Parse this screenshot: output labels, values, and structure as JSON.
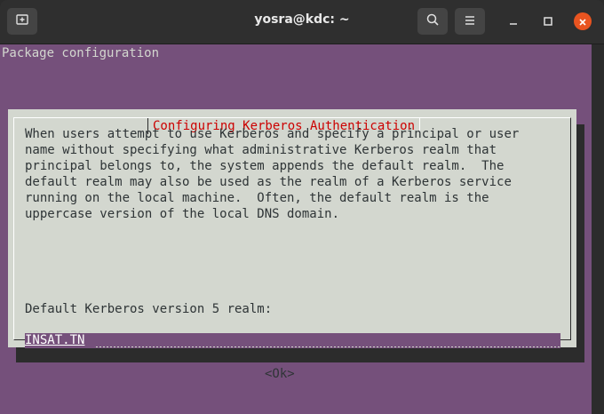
{
  "window": {
    "title": "yosra@kdc: ~"
  },
  "terminal": {
    "header_line": "Package configuration"
  },
  "dialog": {
    "title": "Configuring Kerberos Authentication",
    "description": "When users attempt to use Kerberos and specify a principal or user\nname without specifying what administrative Kerberos realm that\nprincipal belongs to, the system appends the default realm.  The\ndefault realm may also be used as the realm of a Kerberos service\nrunning on the local machine.  Often, the default realm is the\nuppercase version of the local DNS domain.",
    "prompt": "Default Kerberos version 5 realm:",
    "realm_value": "INSAT.TN",
    "ok_label": "<Ok>"
  },
  "icons": {
    "new_tab": "new-tab-icon",
    "search": "search-icon",
    "menu": "hamburger-menu-icon",
    "minimize": "minimize-icon",
    "maximize": "maximize-icon",
    "close": "close-icon"
  },
  "colors": {
    "terminal_bg": "#75507b",
    "dialog_bg": "#d3d7cf",
    "dialog_title": "#cc0000",
    "close_button": "#e95420"
  }
}
